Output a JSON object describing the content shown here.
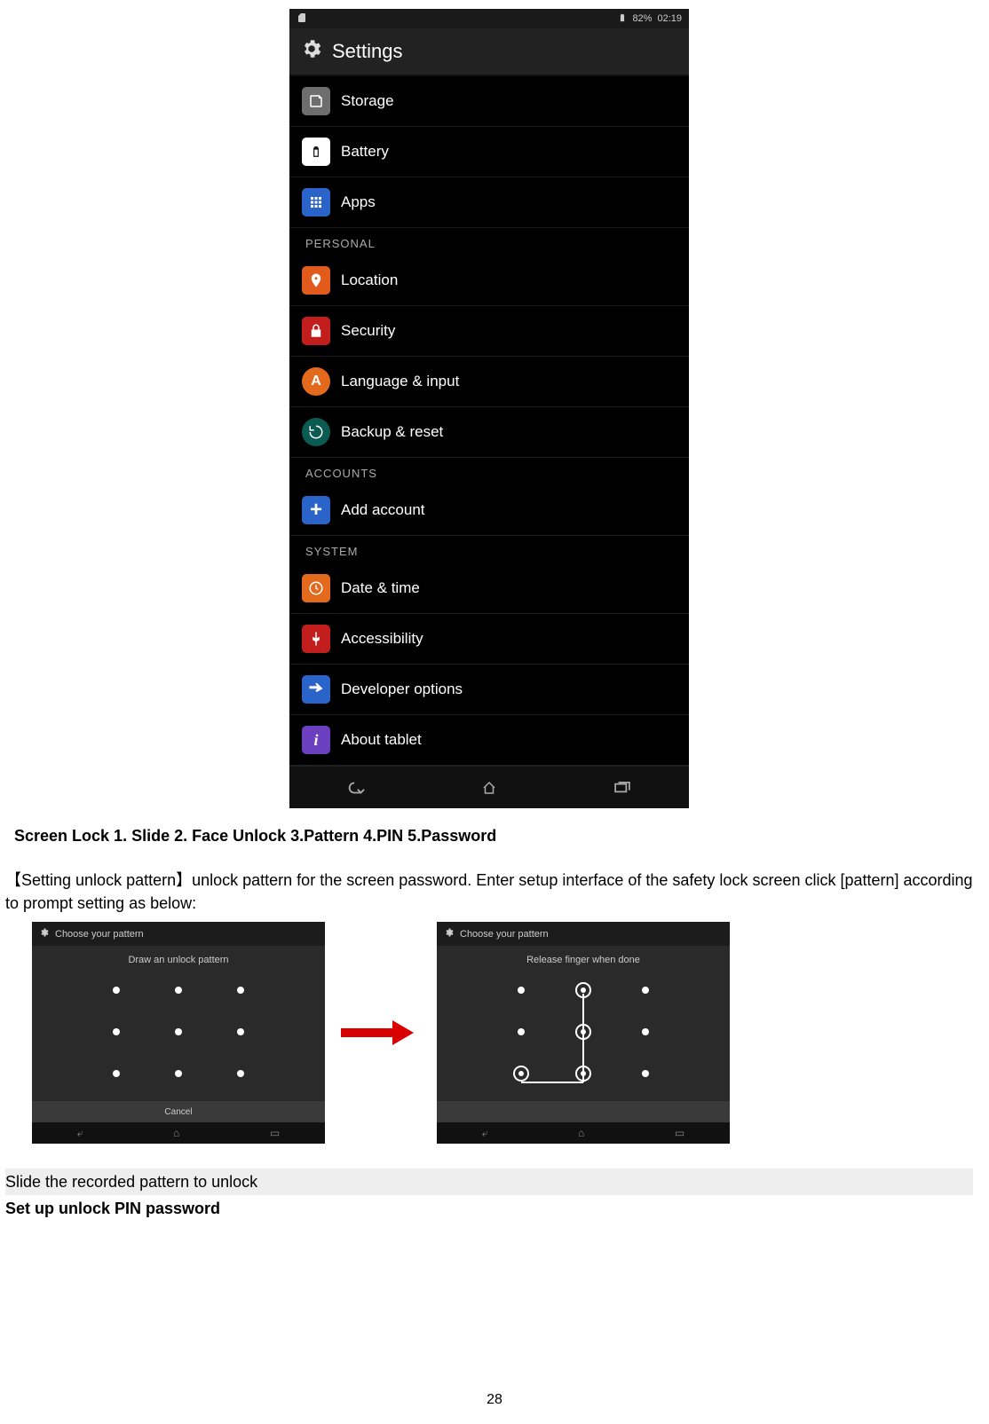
{
  "screenshot_settings": {
    "status": {
      "battery_pct": "82%",
      "time": "02:19"
    },
    "title": "Settings",
    "items": [
      {
        "icon": "storage-icon",
        "label": "Storage"
      },
      {
        "icon": "battery-icon",
        "label": "Battery"
      },
      {
        "icon": "apps-icon",
        "label": "Apps"
      }
    ],
    "section_personal": "PERSONAL",
    "personal_items": [
      {
        "icon": "location-icon",
        "label": "Location"
      },
      {
        "icon": "security-icon",
        "label": "Security"
      },
      {
        "icon": "language-icon",
        "label": "Language & input"
      },
      {
        "icon": "backup-icon",
        "label": "Backup & reset"
      }
    ],
    "section_accounts": "ACCOUNTS",
    "accounts_items": [
      {
        "icon": "add-account-icon",
        "label": "Add account"
      }
    ],
    "section_system": "SYSTEM",
    "system_items": [
      {
        "icon": "datetime-icon",
        "label": "Date & time"
      },
      {
        "icon": "accessibility-icon",
        "label": "Accessibility"
      },
      {
        "icon": "developer-icon",
        "label": "Developer options"
      },
      {
        "icon": "about-icon",
        "label": "About tablet"
      }
    ]
  },
  "doc": {
    "heading_screenlock": "Screen Lock 1. Slide 2. Face Unlock 3.Pattern 4.PIN 5.Password",
    "para_pattern": "【Setting unlock pattern】unlock pattern for the screen password. Enter setup interface of the safety lock screen click [pattern] according to prompt setting as below:",
    "slide_line": "Slide the recorded pattern to unlock",
    "setup_pin": "Set up unlock PIN password",
    "page_number": "28"
  },
  "pattern_screens": {
    "title": "Choose your pattern",
    "hint1": "Draw an unlock pattern",
    "hint2": "Release finger when done",
    "cancel": "Cancel"
  }
}
